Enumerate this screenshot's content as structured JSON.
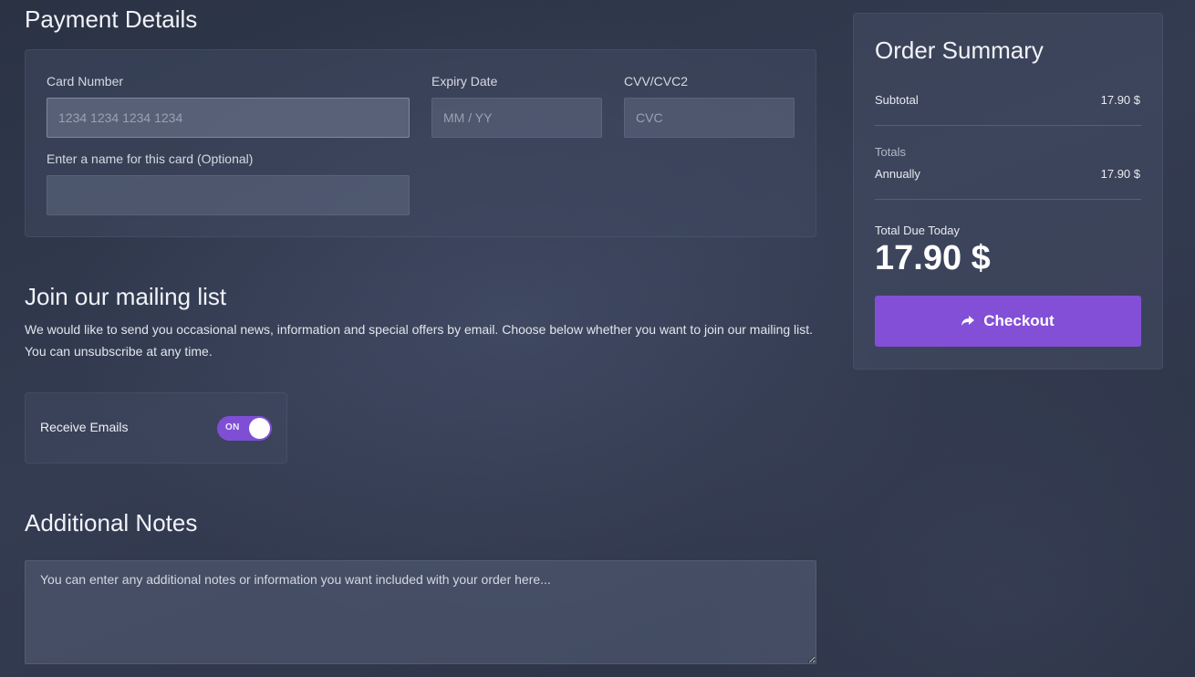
{
  "payment": {
    "title": "Payment Details",
    "card_number_label": "Card Number",
    "card_number_placeholder": "1234 1234 1234 1234",
    "expiry_label": "Expiry Date",
    "expiry_placeholder": "MM / YY",
    "cvv_label": "CVV/CVC2",
    "cvv_placeholder": "CVC",
    "card_name_label": "Enter a name for this card (Optional)",
    "card_name_value": ""
  },
  "mailing": {
    "title": "Join our mailing list",
    "description": "We would like to send you occasional news, information and special offers by email. Choose below whether you want to join our mailing list. You can unsubscribe at any time.",
    "receive_label": "Receive Emails",
    "toggle_state": "ON",
    "toggle_on": true
  },
  "notes": {
    "title": "Additional Notes",
    "placeholder": "You can enter any additional notes or information you want included with your order here..."
  },
  "summary": {
    "title": "Order Summary",
    "subtotal_label": "Subtotal",
    "subtotal_value": "17.90 $",
    "totals_heading": "Totals",
    "annually_label": "Annually",
    "annually_value": "17.90 $",
    "total_due_label": "Total Due Today",
    "total_due_value": "17.90 $",
    "checkout_label": "Checkout",
    "checkout_icon": "share-arrow-icon"
  },
  "colors": {
    "accent": "#834fd7",
    "background": "#2e3548"
  }
}
